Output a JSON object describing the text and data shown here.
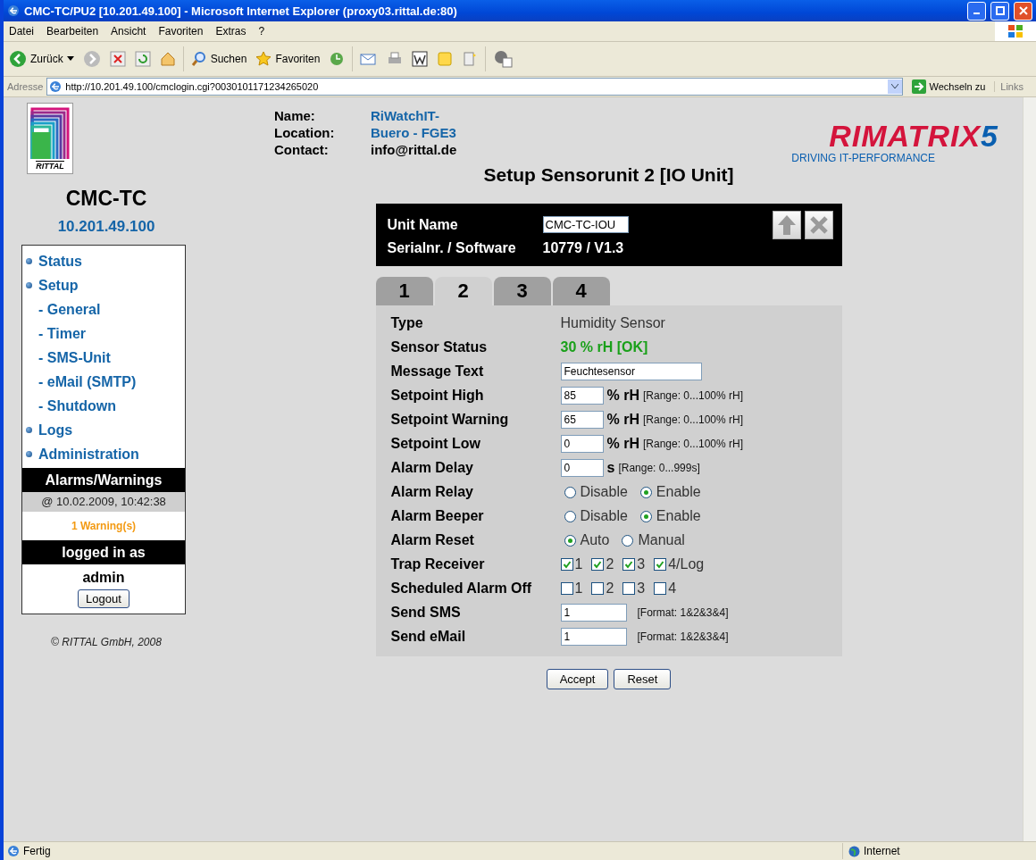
{
  "window": {
    "title": "CMC-TC/PU2 [10.201.49.100] - Microsoft Internet Explorer (proxy03.rittal.de:80)"
  },
  "menu": [
    "Datei",
    "Bearbeiten",
    "Ansicht",
    "Favoriten",
    "Extras",
    "?"
  ],
  "toolbar": {
    "back": "Zurück",
    "search": "Suchen",
    "favorites": "Favoriten"
  },
  "address_bar": {
    "label": "Adresse",
    "url": "http://10.201.49.100/cmclogin.cgi?0030101171234265020",
    "go": "Wechseln zu",
    "links": "Links"
  },
  "sidebar": {
    "logo_text": "RITTAL",
    "device": "CMC-TC",
    "ip": "10.201.49.100",
    "nav": [
      {
        "label": "Status",
        "kind": "main"
      },
      {
        "label": "Setup",
        "kind": "main"
      },
      {
        "label": "- General",
        "kind": "sub"
      },
      {
        "label": "- Timer",
        "kind": "sub"
      },
      {
        "label": "- SMS-Unit",
        "kind": "sub"
      },
      {
        "label": "- eMail (SMTP)",
        "kind": "sub"
      },
      {
        "label": "- Shutdown",
        "kind": "sub"
      },
      {
        "label": "Logs",
        "kind": "main"
      },
      {
        "label": "Administration",
        "kind": "main"
      }
    ],
    "alarms": {
      "title": "Alarms/Warnings",
      "timestamp": "@ 10.02.2009, 10:42:38",
      "message": "1 Warning(s)"
    },
    "session": {
      "title": "logged in as",
      "user": "admin",
      "logout": "Logout"
    },
    "copyright": "© RITTAL GmbH, 2008"
  },
  "header": {
    "info": [
      {
        "label": "Name:",
        "value": "RiWatchIT-",
        "kind": "link"
      },
      {
        "label": "Location:",
        "value": "Buero - FGE3",
        "kind": "link"
      },
      {
        "label": "Contact:",
        "value": "info@rittal.de",
        "kind": "plain"
      }
    ],
    "brand": {
      "name": "RIMATRIX",
      "number": "5",
      "tagline": "DRIVING IT-PERFORMANCE"
    }
  },
  "setup": {
    "title": "Setup Sensorunit 2 [IO Unit]",
    "unit": {
      "name_label": "Unit Name",
      "name_value": "CMC-TC-IOU",
      "serial_label": "Serialnr. / Software",
      "serial_value": "10779 / V1.3"
    },
    "tabs": [
      {
        "label": "1",
        "selected": false
      },
      {
        "label": "2",
        "selected": true
      },
      {
        "label": "3",
        "selected": false
      },
      {
        "label": "4",
        "selected": false
      }
    ],
    "rows": [
      {
        "kind": "text",
        "label": "Type",
        "value": "Humidity Sensor"
      },
      {
        "kind": "status",
        "label": "Sensor Status",
        "value": "30 % rH [OK]"
      },
      {
        "kind": "input",
        "label": "Message Text",
        "value": "Feuchtesensor"
      },
      {
        "kind": "setpoint",
        "label": "Setpoint High",
        "value": "85",
        "unit": "% rH",
        "hint": "[Range: 0...100% rH]"
      },
      {
        "kind": "setpoint",
        "label": "Setpoint Warning",
        "value": "65",
        "unit": "% rH",
        "hint": "[Range: 0...100% rH]"
      },
      {
        "kind": "setpoint",
        "label": "Setpoint Low",
        "value": "0",
        "unit": "% rH",
        "hint": "[Range: 0...100% rH]"
      },
      {
        "kind": "setpoint",
        "label": "Alarm Delay",
        "value": "0",
        "unit": "s",
        "hint": "[Range: 0...999s]"
      },
      {
        "kind": "radio",
        "label": "Alarm Relay",
        "options": [
          {
            "label": "Disable",
            "selected": false
          },
          {
            "label": "Enable",
            "selected": true
          }
        ]
      },
      {
        "kind": "radio",
        "label": "Alarm Beeper",
        "options": [
          {
            "label": "Disable",
            "selected": false
          },
          {
            "label": "Enable",
            "selected": true
          }
        ]
      },
      {
        "kind": "radio",
        "label": "Alarm Reset",
        "options": [
          {
            "label": "Auto",
            "selected": true
          },
          {
            "label": "Manual",
            "selected": false
          }
        ]
      },
      {
        "kind": "checkbox",
        "label": "Trap Receiver",
        "options": [
          {
            "label": "1",
            "checked": true
          },
          {
            "label": "2",
            "checked": true
          },
          {
            "label": "3",
            "checked": true
          },
          {
            "label": "4/Log",
            "checked": true
          }
        ]
      },
      {
        "kind": "checkbox",
        "label": "Scheduled Alarm Off",
        "options": [
          {
            "label": "1",
            "checked": false
          },
          {
            "label": "2",
            "checked": false
          },
          {
            "label": "3",
            "checked": false
          },
          {
            "label": "4",
            "checked": false
          }
        ]
      },
      {
        "kind": "format",
        "label": "Send SMS",
        "value": "1",
        "hint": "[Format: 1&2&3&4]"
      },
      {
        "kind": "format",
        "label": "Send eMail",
        "value": "1",
        "hint": "[Format: 1&2&3&4]"
      }
    ],
    "buttons": [
      "Accept",
      "Reset"
    ]
  },
  "status_bar": {
    "text": "Fertig",
    "zone": "Internet"
  }
}
